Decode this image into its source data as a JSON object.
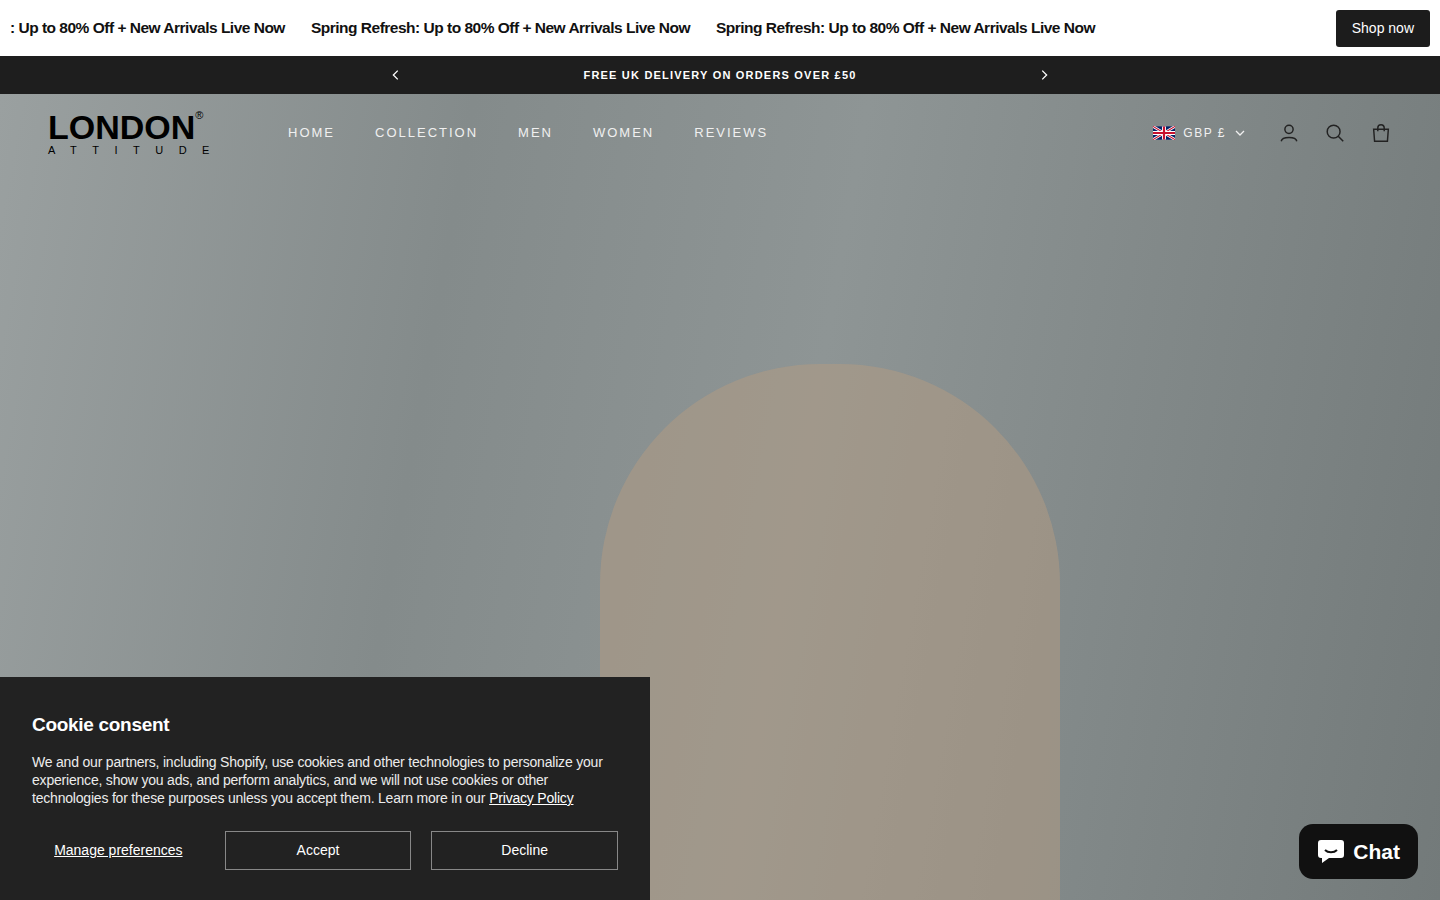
{
  "announcement": {
    "items": [
      ": Up to 80% Off + New Arrivals Live Now",
      "Spring Refresh: Up to 80% Off + New Arrivals Live Now",
      "Spring Refresh: Up to 80% Off + New Arrivals Live Now"
    ],
    "button": "Shop now"
  },
  "promo_bar": {
    "text": "FREE UK DELIVERY ON ORDERS OVER £50"
  },
  "header": {
    "logo": {
      "name": "LONDON",
      "mark": "®",
      "sub": "ATTITUDE"
    },
    "nav": [
      {
        "label": "HOME"
      },
      {
        "label": "COLLECTION"
      },
      {
        "label": "MEN"
      },
      {
        "label": "WOMEN"
      },
      {
        "label": "REVIEWS"
      }
    ],
    "currency": "GBP £"
  },
  "cookie": {
    "title": "Cookie consent",
    "text": "We and our partners, including Shopify, use cookies and other technologies to personalize your experience, show you ads, and perform analytics, and we will not use cookies or other technologies for these purposes unless you accept them. Learn more in our",
    "link": "Privacy Policy",
    "manage": "Manage preferences",
    "accept": "Accept",
    "decline": "Decline"
  },
  "chat": {
    "label": "Chat"
  }
}
